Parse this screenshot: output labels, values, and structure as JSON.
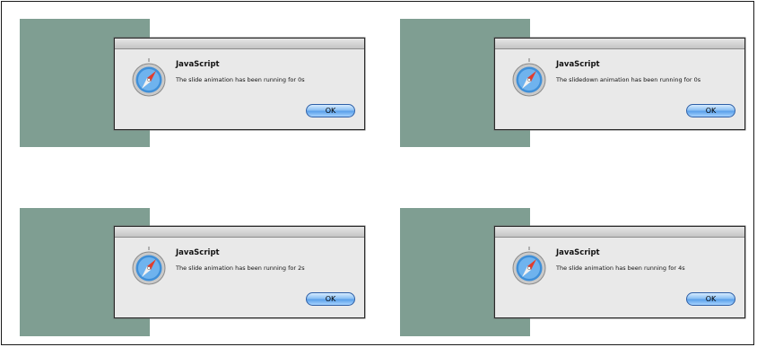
{
  "panels": [
    {
      "title": "JavaScript",
      "message": "The slide animation has been running for 0s",
      "ok_label": "OK",
      "icon": "safari-compass-icon"
    },
    {
      "title": "JavaScript",
      "message": "The slidedown animation has been running for 0s",
      "ok_label": "OK",
      "icon": "safari-compass-icon"
    },
    {
      "title": "JavaScript",
      "message": "The slide animation has been running for 2s",
      "ok_label": "OK",
      "icon": "safari-compass-icon"
    },
    {
      "title": "JavaScript",
      "message": "The slide animation has been running for 4s",
      "ok_label": "OK",
      "icon": "safari-compass-icon"
    }
  ],
  "colors": {
    "animated_box": "#7f9e92",
    "dialog_background": "#e9e9e9",
    "ok_button_blue": "#5aa0ea"
  }
}
